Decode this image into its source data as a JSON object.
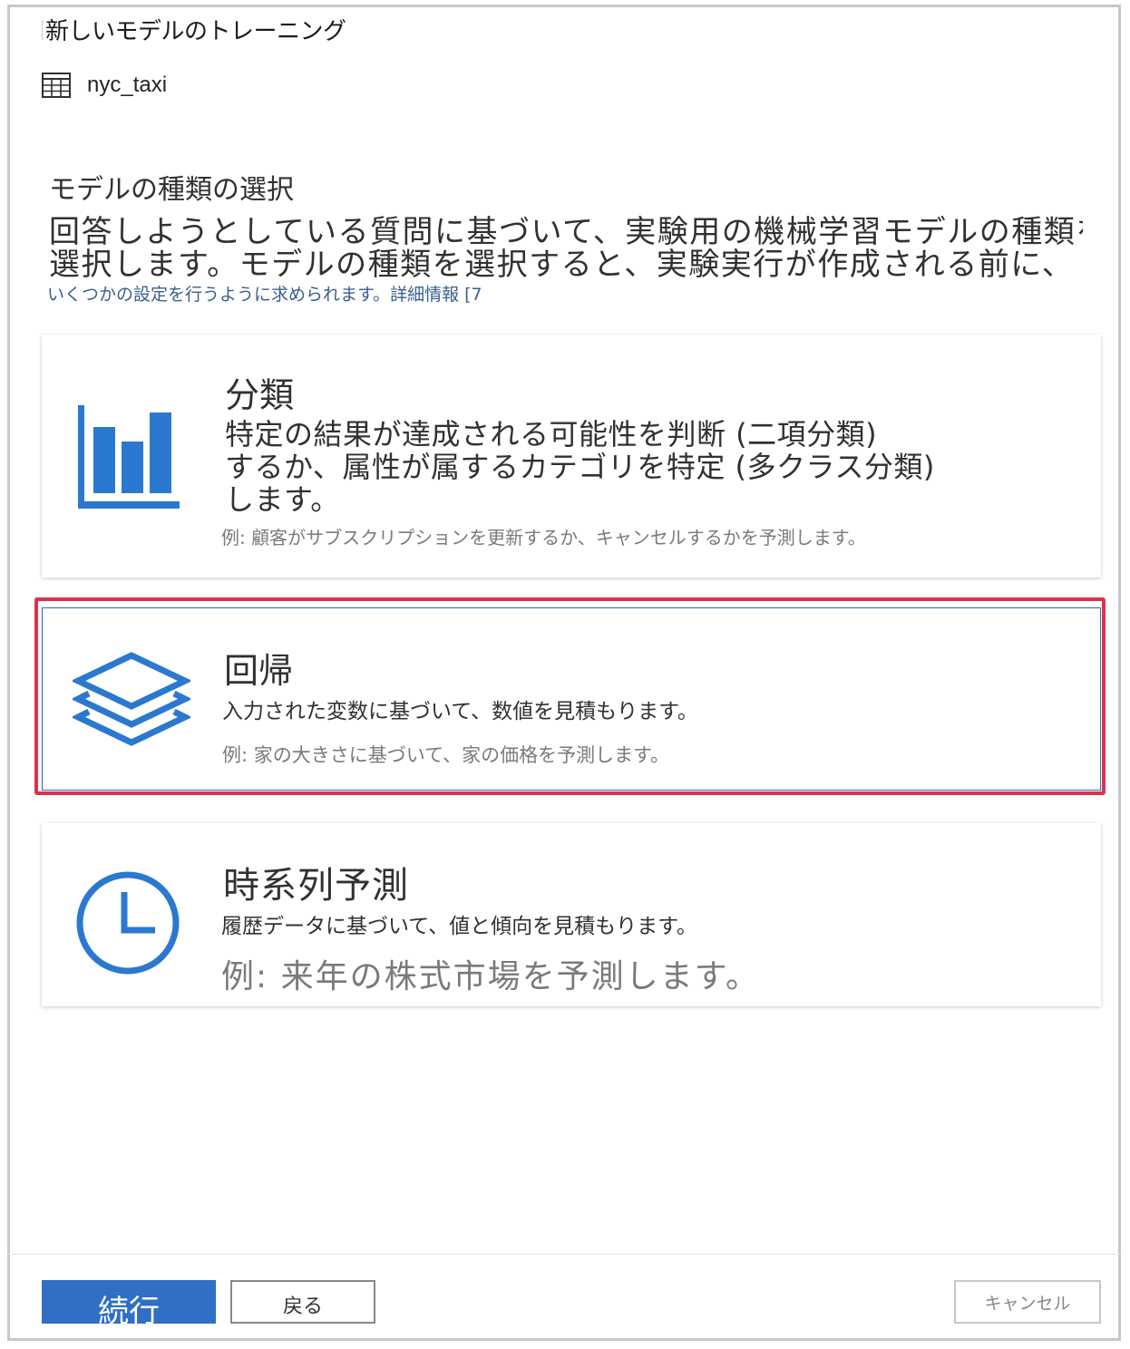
{
  "dialog": {
    "title": "新しいモデルのトレーニング",
    "dataset_name": "nyc_taxi"
  },
  "section": {
    "heading": "モデルの種類の選択",
    "description_line1": "回答しようとしている質問に基づいて、実験用の機械学習モデルの種類を",
    "description_line2": "選択します。モデルの種類を選択すると、実験実行が作成される前に、",
    "sub_text": "いくつかの設定を行うように求められます。",
    "learn_more_link": "詳細情報 [7"
  },
  "cards": [
    {
      "title": "分類",
      "description_lines": [
        "特定の結果が達成される可能性を判断 (二項分類)",
        "するか、属性が属するカテゴリを特定 (多クラス分類)",
        "します。"
      ],
      "example": "例: 顧客がサブスクリプションを更新するか、キャンセルするかを予測します。",
      "icon": "bar-chart-icon"
    },
    {
      "title": "回帰",
      "description_lines": [
        "入力された変数に基づいて、数値を見積もります。"
      ],
      "example": "例: 家の大きさに基づいて、家の価格を予測します。",
      "icon": "layers-icon",
      "selected": true
    },
    {
      "title": "時系列予測",
      "description_lines": [
        "履歴データに基づいて、値と傾向を見積もります。"
      ],
      "example": "例: 来年の株式市場を予測します。",
      "icon": "clock-icon"
    }
  ],
  "footer": {
    "continue_label": "続行",
    "back_label": "戻る",
    "cancel_label": "キャンセル"
  },
  "colors": {
    "accent": "#2f6fc5",
    "icon_blue": "#2b78d0",
    "highlight_red": "#e0304a",
    "link": "#3a5f8c"
  }
}
